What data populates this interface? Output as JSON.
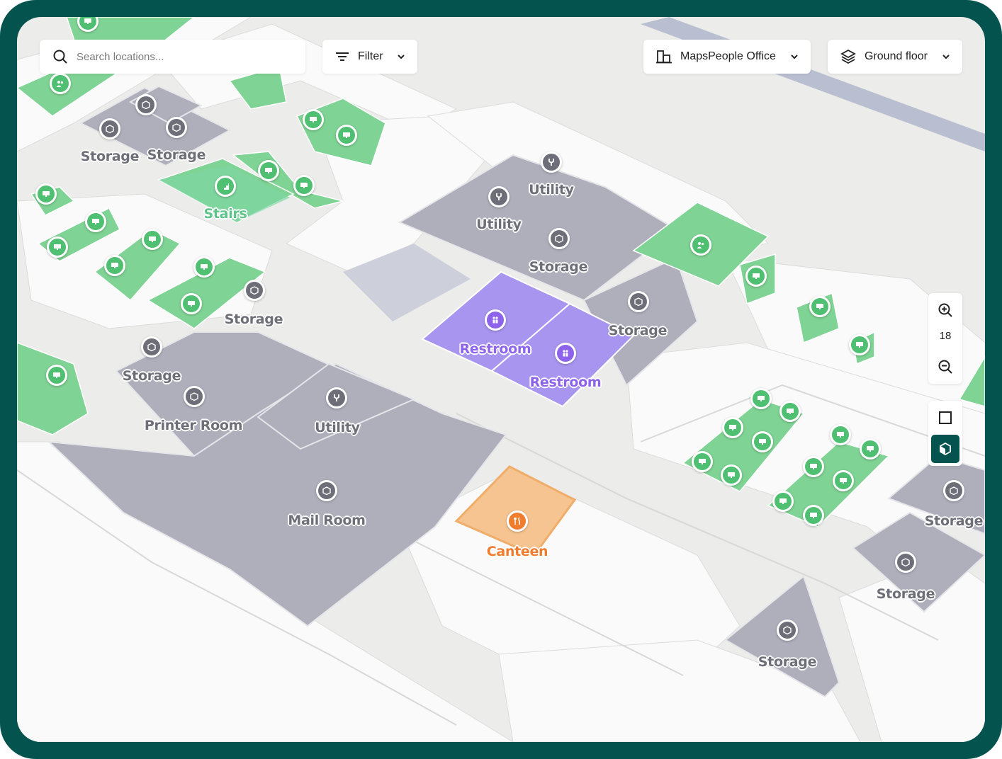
{
  "search": {
    "placeholder": "Search locations..."
  },
  "filter": {
    "label": "Filter"
  },
  "venue": {
    "label": "MapsPeople Office"
  },
  "floor": {
    "label": "Ground floor"
  },
  "zoom": {
    "level": "18"
  },
  "colors": {
    "frame": "#04534f",
    "storage": "#6d6e78",
    "meeting": "#4fbf72",
    "restroom": "#8c63ea",
    "canteen": "#f07c2d"
  },
  "rooms": [
    {
      "name": "Storage",
      "category": "storage"
    },
    {
      "name": "Storage",
      "category": "storage"
    },
    {
      "name": "Stairs",
      "category": "stairs"
    },
    {
      "name": "Utility",
      "category": "utility"
    },
    {
      "name": "Utility",
      "category": "utility"
    },
    {
      "name": "Storage",
      "category": "storage"
    },
    {
      "name": "Storage",
      "category": "storage"
    },
    {
      "name": "Restroom",
      "category": "restroom"
    },
    {
      "name": "Restroom",
      "category": "restroom"
    },
    {
      "name": "Storage",
      "category": "storage"
    },
    {
      "name": "Storage",
      "category": "storage"
    },
    {
      "name": "Printer Room",
      "category": "storage"
    },
    {
      "name": "Utility",
      "category": "utility"
    },
    {
      "name": "Mail Room",
      "category": "storage"
    },
    {
      "name": "Canteen",
      "category": "canteen"
    },
    {
      "name": "Storage",
      "category": "storage"
    },
    {
      "name": "Storage",
      "category": "storage"
    },
    {
      "name": "Storage",
      "category": "storage"
    }
  ]
}
